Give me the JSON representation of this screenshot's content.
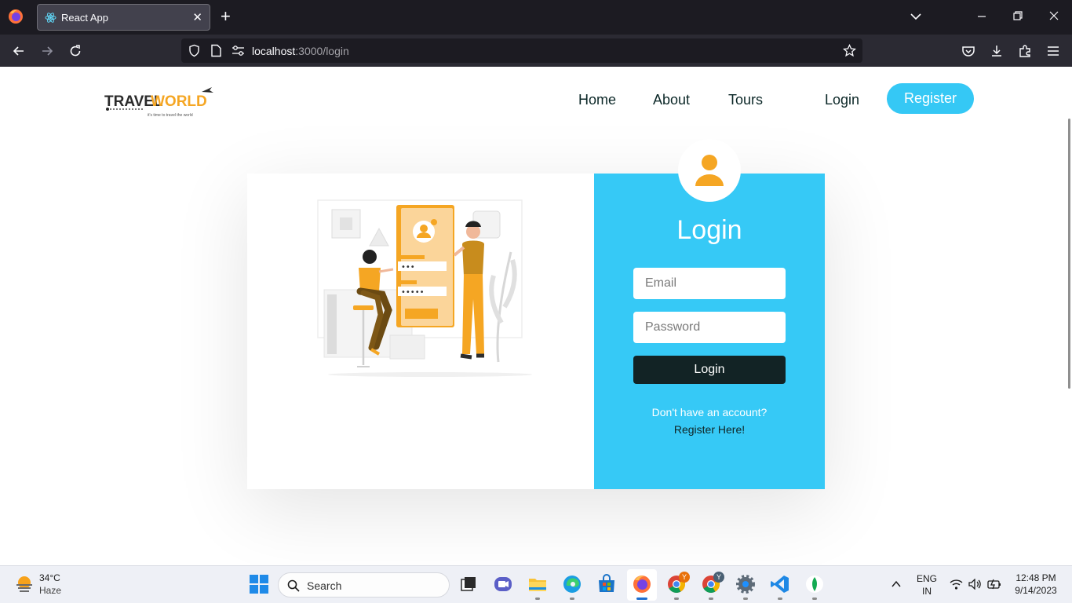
{
  "browser": {
    "tab_title": "React App",
    "tab_close": "✕",
    "new_tab": "+",
    "url_host": "localhost",
    "url_path": ":3000/login"
  },
  "site": {
    "logo_text": "TRAVELWORLD",
    "logo_tagline": "it's time to travel the world",
    "nav": {
      "home": "Home",
      "about": "About",
      "tours": "Tours",
      "login": "Login",
      "register": "Register"
    }
  },
  "login_form": {
    "title": "Login",
    "email_placeholder": "Email",
    "password_placeholder": "Password",
    "submit_label": "Login",
    "no_account_text": "Don't have an account?",
    "register_link": "Register Here!"
  },
  "taskbar": {
    "weather_temp": "34°C",
    "weather_condition": "Haze",
    "search_label": "Search",
    "language": "ENG",
    "region": "IN",
    "time": "12:48 PM",
    "date": "9/14/2023",
    "badge_y": "Y"
  },
  "colors": {
    "accent": "#36c9f6",
    "dark_button": "#122325",
    "illustration_orange": "#f5a623"
  }
}
